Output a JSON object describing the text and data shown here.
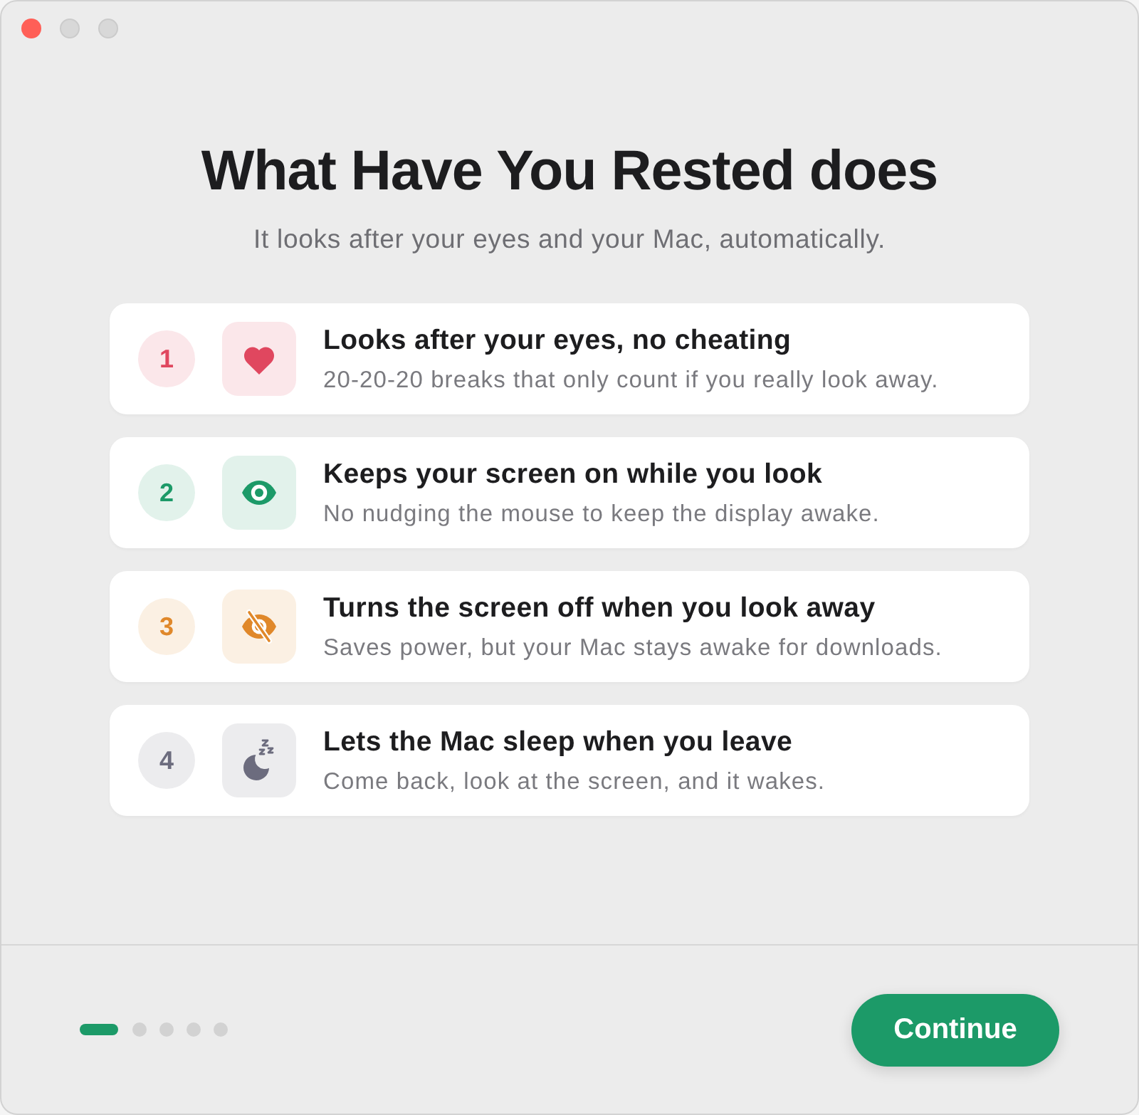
{
  "window": {
    "controls": [
      {
        "kind": "close",
        "disabled": false
      },
      {
        "kind": "minimize",
        "disabled": true
      },
      {
        "kind": "zoom",
        "disabled": true
      }
    ]
  },
  "header": {
    "title": "What Have You Rested does",
    "subtitle": "It looks after your eyes and your Mac, automatically."
  },
  "features": [
    {
      "number": "1",
      "title": "Looks after your eyes, no cheating",
      "description": "20-20-20 breaks that only count if you really look away.",
      "color": "#e0475f"
    },
    {
      "number": "2",
      "title": "Keeps your screen on while you look",
      "description": "No nudging the mouse to keep the display awake.",
      "color": "#1c9a68"
    },
    {
      "number": "3",
      "title": "Turns the screen off when you look away",
      "description": "Saves power, but your Mac stays awake for downloads.",
      "color": "#e0882a"
    },
    {
      "number": "4",
      "title": "Lets the Mac sleep when you leave",
      "description": "Come back, look at the screen, and it wakes.",
      "color": "#6c6c7e"
    }
  ],
  "footer": {
    "pages": [
      {
        "selected": true
      },
      {
        "selected": false
      },
      {
        "selected": false
      },
      {
        "selected": false
      },
      {
        "selected": false
      }
    ],
    "button": "Continue"
  }
}
